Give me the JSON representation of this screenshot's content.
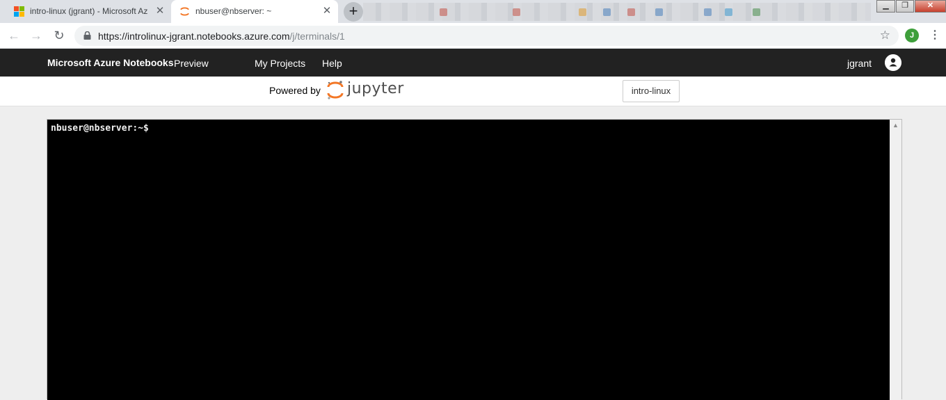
{
  "browser": {
    "tabs": [
      {
        "title": "intro-linux (jgrant) - Microsoft Az",
        "favicon": "microsoft-logo-icon",
        "active": false
      },
      {
        "title": "nbuser@nbserver: ~",
        "favicon": "jupyter-logo-icon",
        "active": true
      }
    ],
    "new_tab_icon": "+",
    "close_icon": "✕",
    "window_buttons": {
      "minimize": "▁",
      "maximize": "❐",
      "close": "✕"
    },
    "url_host": "https://introlinux-jgrant.notebooks.azure.com",
    "url_path": "/j/terminals/1",
    "profile_initial": "J"
  },
  "azure_header": {
    "brand": "Microsoft Azure Notebooks",
    "preview": "Preview",
    "nav": [
      "My Projects",
      "Help"
    ],
    "username": "jgrant"
  },
  "jupyter_header": {
    "powered_by": "Powered by",
    "logo_text": "jupyter",
    "project_button": "intro-linux"
  },
  "terminal": {
    "prompt": "nbuser@nbserver:~$"
  },
  "colors": {
    "azure_bar": "#222222",
    "jupyter_orange": "#f37726",
    "terminal_bg": "#000000"
  }
}
